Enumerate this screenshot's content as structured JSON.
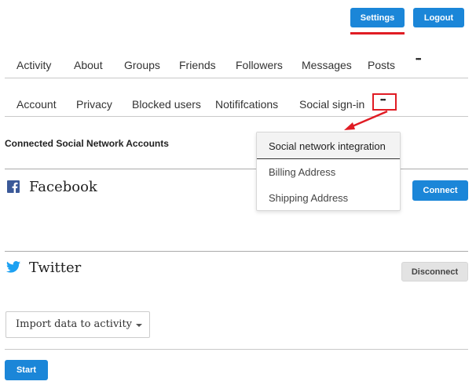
{
  "header": {
    "settings_label": "Settings",
    "logout_label": "Logout"
  },
  "primary_nav": [
    "Activity",
    "About",
    "Groups",
    "Friends",
    "Followers",
    "Messages",
    "Posts",
    "•••"
  ],
  "secondary_nav": [
    "Account",
    "Privacy",
    "Blocked users",
    "Notififcations",
    "Social sign-in",
    "•••"
  ],
  "dropdown": {
    "items": [
      "Social network integration",
      "Billing Address",
      "Shipping Address"
    ],
    "active_index": 0
  },
  "section_title": "Connected Social Network Accounts",
  "accounts": [
    {
      "name": "Facebook",
      "icon": "facebook-icon",
      "action_label": "Connect"
    },
    {
      "name": "Twitter",
      "icon": "twitter-icon",
      "action_label": "Disconnect"
    }
  ],
  "import_select": {
    "label": "Import data to activity"
  },
  "start_label": "Start",
  "colors": {
    "primary": "#1b86d8",
    "annotation": "#e01c24",
    "facebook": "#3b5998",
    "twitter": "#1da1f2"
  }
}
